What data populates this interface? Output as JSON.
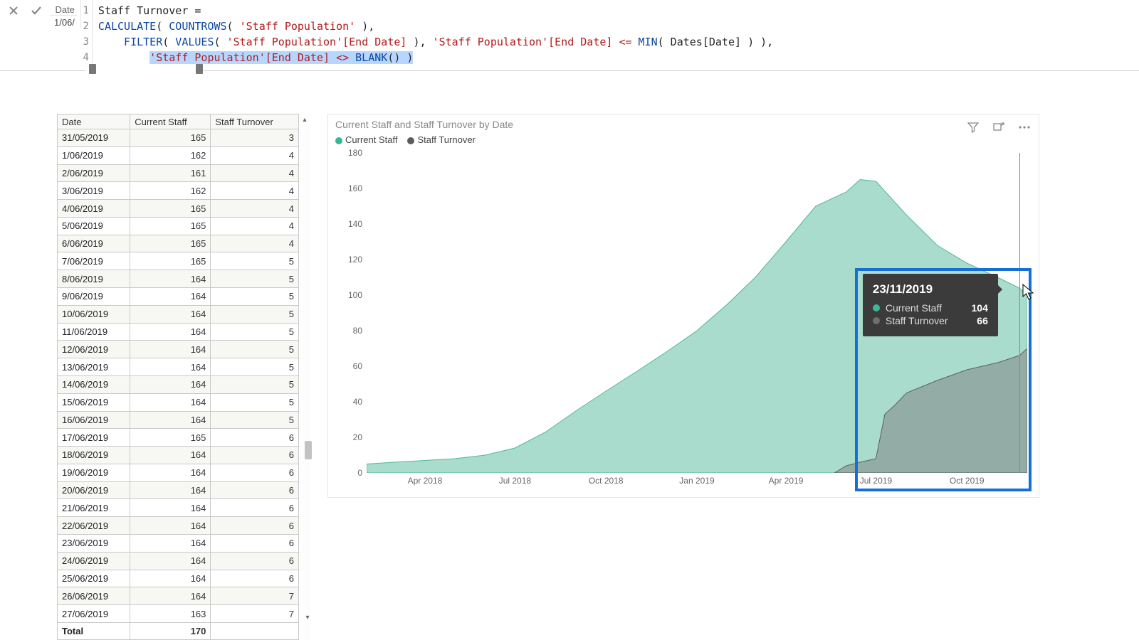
{
  "formula_bar": {
    "cancel_field_label": "Date",
    "cancel_field_value": "1/06/",
    "lines": [
      "1",
      "2",
      "3",
      "4"
    ],
    "measure_name": "Staff Turnover",
    "code_line1": "Staff Turnover = ",
    "code_line2_fn": "CALCULATE",
    "code_line2_fn2": "COUNTROWS",
    "code_line2_tbl": " 'Staff Population' ",
    "code_line3_fn": "FILTER",
    "code_line3_fn2": "VALUES",
    "code_line3_col": " 'Staff Population'[End Date] ",
    "code_line3_cmp": "'Staff Population'[End Date] <= ",
    "code_line3_min": "MIN",
    "code_line3_minarg": " Dates[Date] ",
    "code_line4_expr": "'Staff Population'[End Date] <> ",
    "code_line4_blank": "BLANK"
  },
  "table": {
    "columns": [
      "Date",
      "Current Staff",
      "Staff Turnover"
    ],
    "rows": [
      [
        "31/05/2019",
        "165",
        "3"
      ],
      [
        "1/06/2019",
        "162",
        "4"
      ],
      [
        "2/06/2019",
        "161",
        "4"
      ],
      [
        "3/06/2019",
        "162",
        "4"
      ],
      [
        "4/06/2019",
        "165",
        "4"
      ],
      [
        "5/06/2019",
        "165",
        "4"
      ],
      [
        "6/06/2019",
        "165",
        "4"
      ],
      [
        "7/06/2019",
        "165",
        "5"
      ],
      [
        "8/06/2019",
        "164",
        "5"
      ],
      [
        "9/06/2019",
        "164",
        "5"
      ],
      [
        "10/06/2019",
        "164",
        "5"
      ],
      [
        "11/06/2019",
        "164",
        "5"
      ],
      [
        "12/06/2019",
        "164",
        "5"
      ],
      [
        "13/06/2019",
        "164",
        "5"
      ],
      [
        "14/06/2019",
        "164",
        "5"
      ],
      [
        "15/06/2019",
        "164",
        "5"
      ],
      [
        "16/06/2019",
        "164",
        "5"
      ],
      [
        "17/06/2019",
        "165",
        "6"
      ],
      [
        "18/06/2019",
        "164",
        "6"
      ],
      [
        "19/06/2019",
        "164",
        "6"
      ],
      [
        "20/06/2019",
        "164",
        "6"
      ],
      [
        "21/06/2019",
        "164",
        "6"
      ],
      [
        "22/06/2019",
        "164",
        "6"
      ],
      [
        "23/06/2019",
        "164",
        "6"
      ],
      [
        "24/06/2019",
        "164",
        "6"
      ],
      [
        "25/06/2019",
        "164",
        "6"
      ],
      [
        "26/06/2019",
        "164",
        "7"
      ],
      [
        "27/06/2019",
        "163",
        "7"
      ]
    ],
    "total_label": "Total",
    "total_value": "170"
  },
  "chart_data": {
    "type": "area",
    "title": "Current Staff and Staff Turnover by Date",
    "legend": [
      "Current Staff",
      "Staff Turnover"
    ],
    "colors": {
      "current_staff": "#6fc6ae",
      "staff_turnover": "#797f7f"
    },
    "ylim": [
      0,
      180
    ],
    "yticks": [
      0,
      20,
      40,
      60,
      80,
      100,
      120,
      140,
      160,
      180
    ],
    "xticks": [
      "Apr 2018",
      "Jul 2018",
      "Oct 2018",
      "Jan 2019",
      "Apr 2019",
      "Jul 2019",
      "Oct 2019"
    ],
    "x_range": [
      "2018-02-01",
      "2019-12-01"
    ],
    "series": [
      {
        "name": "Current Staff",
        "color": "#6fc6ae",
        "x": [
          "2018-02-01",
          "2018-03-01",
          "2018-04-01",
          "2018-05-01",
          "2018-06-01",
          "2018-07-01",
          "2018-08-01",
          "2018-09-01",
          "2018-10-01",
          "2018-11-01",
          "2018-12-01",
          "2019-01-01",
          "2019-02-01",
          "2019-03-01",
          "2019-04-01",
          "2019-05-01",
          "2019-06-01",
          "2019-06-15",
          "2019-07-01",
          "2019-08-01",
          "2019-09-01",
          "2019-10-01",
          "2019-11-01",
          "2019-11-23",
          "2019-12-01"
        ],
        "values": [
          5,
          6,
          7,
          8,
          10,
          14,
          23,
          35,
          46,
          57,
          68,
          80,
          95,
          110,
          130,
          150,
          158,
          165,
          164,
          145,
          128,
          118,
          110,
          104,
          100
        ]
      },
      {
        "name": "Staff Turnover",
        "color": "#797f7f",
        "x": [
          "2019-05-20",
          "2019-06-01",
          "2019-06-15",
          "2019-07-01",
          "2019-07-10",
          "2019-07-20",
          "2019-08-01",
          "2019-09-01",
          "2019-10-01",
          "2019-11-01",
          "2019-11-23",
          "2019-12-01"
        ],
        "values": [
          0,
          4,
          6,
          8,
          33,
          38,
          45,
          52,
          58,
          62,
          66,
          70
        ]
      }
    ],
    "tooltip": {
      "date": "23/11/2019",
      "items": [
        {
          "label": "Current Staff",
          "value": "104",
          "color": "#3fb59a"
        },
        {
          "label": "Staff Turnover",
          "value": "66",
          "color": "#6b6f6f"
        }
      ]
    }
  }
}
